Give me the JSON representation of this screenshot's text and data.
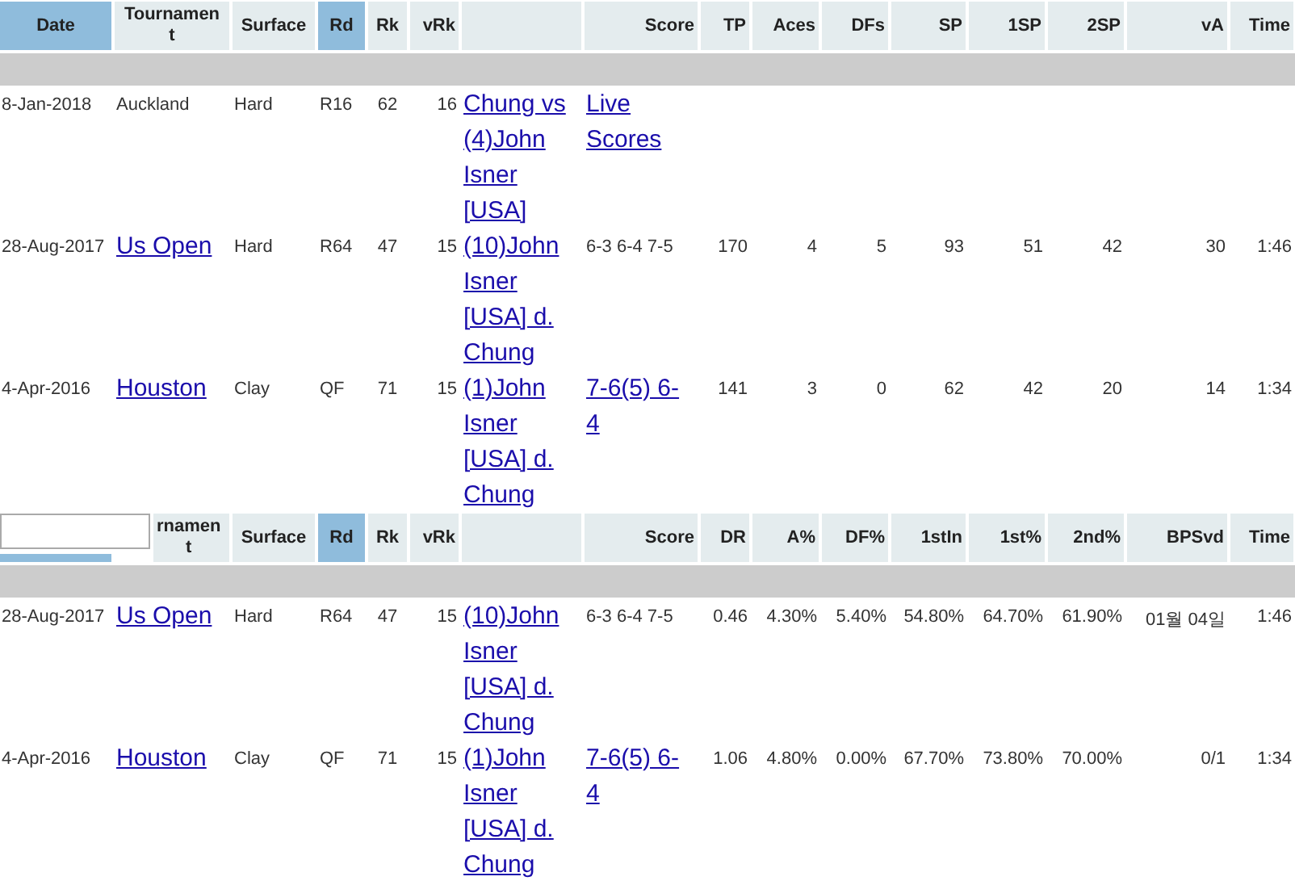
{
  "tables": [
    {
      "columns": [
        {
          "label": "Date",
          "selected": true,
          "kind": "label"
        },
        {
          "label": "Tournamen\nt",
          "selected": false,
          "kind": "label"
        },
        {
          "label": "Surface",
          "selected": false,
          "kind": "label"
        },
        {
          "label": "Rd",
          "selected": true,
          "kind": "label"
        },
        {
          "label": "Rk",
          "selected": false,
          "kind": "label"
        },
        {
          "label": "vRk",
          "selected": false,
          "kind": "label"
        },
        {
          "selected": false,
          "kind": "blank"
        },
        {
          "label": "Score",
          "selected": false,
          "kind": "label"
        },
        {
          "label": "TP",
          "selected": false,
          "kind": "label"
        },
        {
          "label": "Aces",
          "selected": false,
          "kind": "label"
        },
        {
          "label": "DFs",
          "selected": false,
          "kind": "label"
        },
        {
          "label": "SP",
          "selected": false,
          "kind": "label"
        },
        {
          "label": "1SP",
          "selected": false,
          "kind": "label"
        },
        {
          "label": "2SP",
          "selected": false,
          "kind": "label"
        },
        {
          "label": "vA",
          "selected": false,
          "kind": "label"
        },
        {
          "label": "Time",
          "selected": false,
          "kind": "label"
        }
      ],
      "rows": [
        {
          "cells": [
            {
              "text": "8-Jan-2018",
              "kind": "text"
            },
            {
              "text": "Auckland",
              "kind": "text"
            },
            {
              "text": "Hard",
              "kind": "text"
            },
            {
              "text": "R16",
              "kind": "text"
            },
            {
              "text": "62",
              "kind": "text"
            },
            {
              "text": "16",
              "kind": "text"
            },
            {
              "text": "Chung vs (4)John Isner [USA]",
              "kind": "link"
            },
            {
              "text": "Live Scores",
              "kind": "link"
            }
          ]
        },
        {
          "cells": [
            {
              "text": "28-Aug-2017",
              "kind": "text"
            },
            {
              "text": "Us Open",
              "kind": "link"
            },
            {
              "text": "Hard",
              "kind": "text"
            },
            {
              "text": "R64",
              "kind": "text"
            },
            {
              "text": "47",
              "kind": "text"
            },
            {
              "text": "15",
              "kind": "text"
            },
            {
              "text": "(10)John Isner [USA] d. Chung",
              "kind": "link"
            },
            {
              "text": "6-3 6-4 7-5",
              "kind": "text"
            },
            {
              "text": "170",
              "kind": "text"
            },
            {
              "text": "4",
              "kind": "text"
            },
            {
              "text": "5",
              "kind": "text"
            },
            {
              "text": "93",
              "kind": "text"
            },
            {
              "text": "51",
              "kind": "text"
            },
            {
              "text": "42",
              "kind": "text"
            },
            {
              "text": "30",
              "kind": "text"
            },
            {
              "text": "1:46",
              "kind": "text"
            }
          ]
        },
        {
          "cells": [
            {
              "text": "4-Apr-2016",
              "kind": "text"
            },
            {
              "text": "Houston",
              "kind": "link"
            },
            {
              "text": "Clay",
              "kind": "text"
            },
            {
              "text": "QF",
              "kind": "text"
            },
            {
              "text": "71",
              "kind": "text"
            },
            {
              "text": "15",
              "kind": "text"
            },
            {
              "text": "(1)John Isner [USA] d. Chung",
              "kind": "link"
            },
            {
              "text": "7-6(5) 6-4",
              "kind": "link"
            },
            {
              "text": "141",
              "kind": "text"
            },
            {
              "text": "3",
              "kind": "text"
            },
            {
              "text": "0",
              "kind": "text"
            },
            {
              "text": "62",
              "kind": "text"
            },
            {
              "text": "42",
              "kind": "text"
            },
            {
              "text": "20",
              "kind": "text"
            },
            {
              "text": "14",
              "kind": "text"
            },
            {
              "text": "1:34",
              "kind": "text"
            }
          ]
        }
      ]
    },
    {
      "columns": [
        {
          "selected": true,
          "kind": "input"
        },
        {
          "label": "rnamen\nt",
          "selected": false,
          "kind": "label"
        },
        {
          "label": "Surface",
          "selected": false,
          "kind": "label"
        },
        {
          "label": "Rd",
          "selected": true,
          "kind": "label"
        },
        {
          "label": "Rk",
          "selected": false,
          "kind": "label"
        },
        {
          "label": "vRk",
          "selected": false,
          "kind": "label"
        },
        {
          "selected": false,
          "kind": "blank"
        },
        {
          "label": "Score",
          "selected": false,
          "kind": "label"
        },
        {
          "label": "DR",
          "selected": false,
          "kind": "label"
        },
        {
          "label": "A%",
          "selected": false,
          "kind": "label"
        },
        {
          "label": "DF%",
          "selected": false,
          "kind": "label"
        },
        {
          "label": "1stIn",
          "selected": false,
          "kind": "label"
        },
        {
          "label": "1st%",
          "selected": false,
          "kind": "label"
        },
        {
          "label": "2nd%",
          "selected": false,
          "kind": "label"
        },
        {
          "label": "BPSvd",
          "selected": false,
          "kind": "label"
        },
        {
          "label": "Time",
          "selected": false,
          "kind": "label"
        }
      ],
      "rows": [
        {
          "cells": [
            {
              "text": "28-Aug-2017",
              "kind": "text"
            },
            {
              "text": "Us Open",
              "kind": "link"
            },
            {
              "text": "Hard",
              "kind": "text"
            },
            {
              "text": "R64",
              "kind": "text"
            },
            {
              "text": "47",
              "kind": "text"
            },
            {
              "text": "15",
              "kind": "text"
            },
            {
              "text": "(10)John Isner [USA] d. Chung",
              "kind": "link"
            },
            {
              "text": "6-3 6-4 7-5",
              "kind": "text"
            },
            {
              "text": "0.46",
              "kind": "text"
            },
            {
              "text": "4.30%",
              "kind": "text"
            },
            {
              "text": "5.40%",
              "kind": "text"
            },
            {
              "text": "54.80%",
              "kind": "text"
            },
            {
              "text": "64.70%",
              "kind": "text"
            },
            {
              "text": "61.90%",
              "kind": "text"
            },
            {
              "text": "01월 04일",
              "kind": "text"
            },
            {
              "text": "1:46",
              "kind": "text"
            }
          ]
        },
        {
          "cells": [
            {
              "text": "4-Apr-2016",
              "kind": "text"
            },
            {
              "text": "Houston",
              "kind": "link"
            },
            {
              "text": "Clay",
              "kind": "text"
            },
            {
              "text": "QF",
              "kind": "text"
            },
            {
              "text": "71",
              "kind": "text"
            },
            {
              "text": "15",
              "kind": "text"
            },
            {
              "text": "(1)John Isner [USA] d. Chung",
              "kind": "link"
            },
            {
              "text": "7-6(5) 6-4",
              "kind": "link"
            },
            {
              "text": "1.06",
              "kind": "text"
            },
            {
              "text": "4.80%",
              "kind": "text"
            },
            {
              "text": "0.00%",
              "kind": "text"
            },
            {
              "text": "67.70%",
              "kind": "text"
            },
            {
              "text": "73.80%",
              "kind": "text"
            },
            {
              "text": "70.00%",
              "kind": "text"
            },
            {
              "text": "0/1",
              "kind": "text"
            },
            {
              "text": "1:34",
              "kind": "text"
            }
          ]
        }
      ]
    }
  ]
}
